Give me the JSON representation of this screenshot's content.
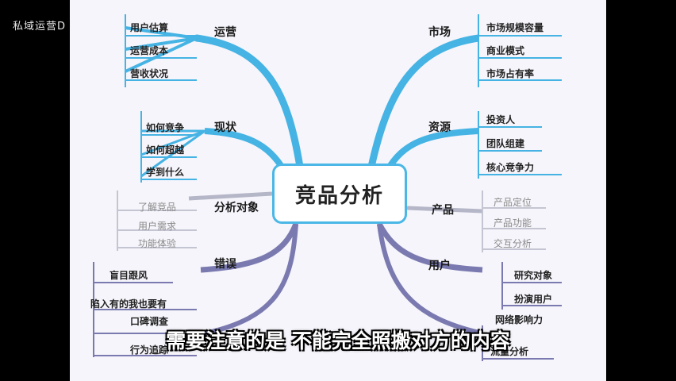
{
  "watermark": "私域运营D",
  "center": "竞品分析",
  "subtitle": "需要注意的是 不能完全照搬对方的内容",
  "branches": {
    "yunying": {
      "label": "运营",
      "items": [
        "用户估算",
        "运营成本",
        "营收状况"
      ]
    },
    "xianzhuang": {
      "label": "现状",
      "items": [
        "如何竞争",
        "如何超越",
        "学到什么"
      ]
    },
    "duixiang": {
      "label": "分析对象",
      "items": [
        "了解竞品",
        "用户需求",
        "功能体验"
      ]
    },
    "cuowu": {
      "label": "错误",
      "items": [
        "盲目跟风",
        "陷入有的我也要有",
        "口碑调查",
        "行为追踪"
      ]
    },
    "shichang": {
      "label": "市场",
      "items": [
        "市场规模容量",
        "商业模式",
        "市场占有率"
      ]
    },
    "ziyuan": {
      "label": "资源",
      "items": [
        "投资人",
        "团队组建",
        "核心竞争力"
      ]
    },
    "chanpin": {
      "label": "产品",
      "items": [
        "产品定位",
        "产品功能",
        "交互分析"
      ]
    },
    "yonghu": {
      "label": "用户",
      "items": [
        "研究对象",
        "扮演用户",
        "网络影响力",
        "流量分析"
      ]
    }
  }
}
